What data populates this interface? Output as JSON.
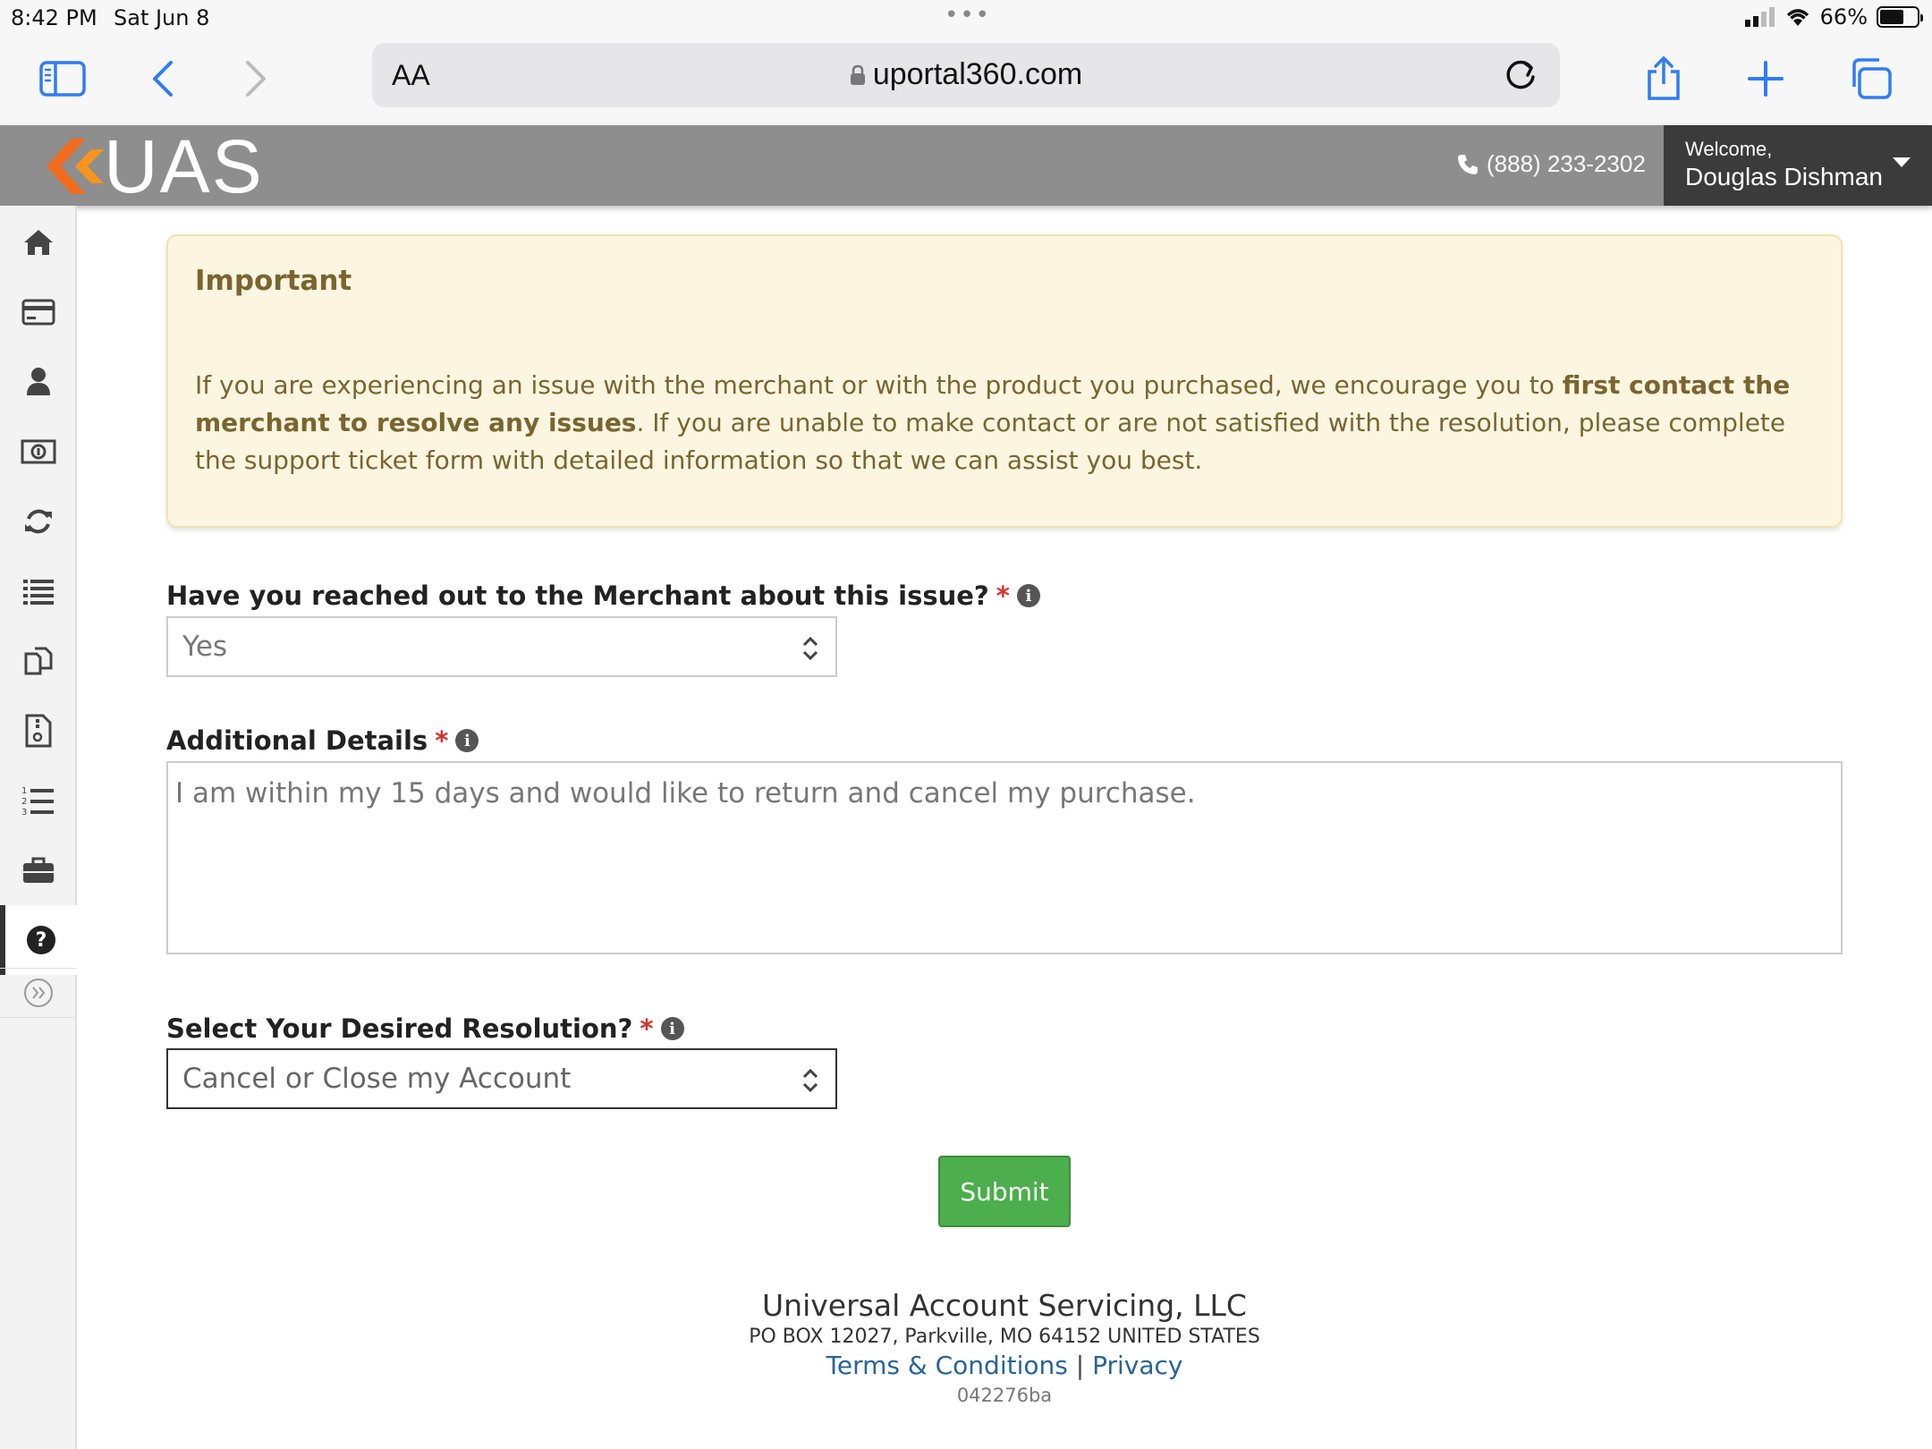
{
  "status_bar": {
    "time": "8:42 PM",
    "date": "Sat Jun 8",
    "battery": "66%",
    "battery_level": 0.66
  },
  "browser": {
    "text_size_label": "AA",
    "url": "uportal360.com"
  },
  "header": {
    "logo_text": "UAS",
    "phone": "(888) 233-2302",
    "welcome_label": "Welcome,",
    "user_name": "Douglas Dishman"
  },
  "sidebar": {
    "items": [
      "home-icon",
      "credit-card-icon",
      "user-icon",
      "money-icon",
      "refresh-icon",
      "list-icon",
      "documents-icon",
      "archive-file-icon",
      "numbered-list-icon",
      "briefcase-icon",
      "help-icon"
    ],
    "active": "help-icon"
  },
  "notice": {
    "title": "Important",
    "body_1": "If you are experiencing an issue with the merchant or with the product you purchased, we encourage you to ",
    "body_bold": "first contact the merchant to resolve any issues",
    "body_2": ". If you are unable to make contact or are not satisfied with the resolution, please complete the support ticket form with detailed information so that we can assist you best."
  },
  "form": {
    "merchant_question": {
      "label": "Have you reached out to the Merchant about this issue?",
      "required_mark": "*",
      "value": "Yes"
    },
    "details": {
      "label": "Additional Details",
      "required_mark": "*",
      "value": "I am within my 15 days and would like to return and cancel my purchase."
    },
    "resolution": {
      "label": "Select Your Desired Resolution?",
      "required_mark": "*",
      "value": "Cancel or Close my Account"
    },
    "submit_label": "Submit"
  },
  "footer": {
    "company": "Universal Account Servicing, LLC",
    "address": "PO BOX 12027, Parkville, MO 64152 UNITED STATES",
    "terms": "Terms & Conditions",
    "separator": "|",
    "privacy": "Privacy",
    "code": "042276ba"
  }
}
